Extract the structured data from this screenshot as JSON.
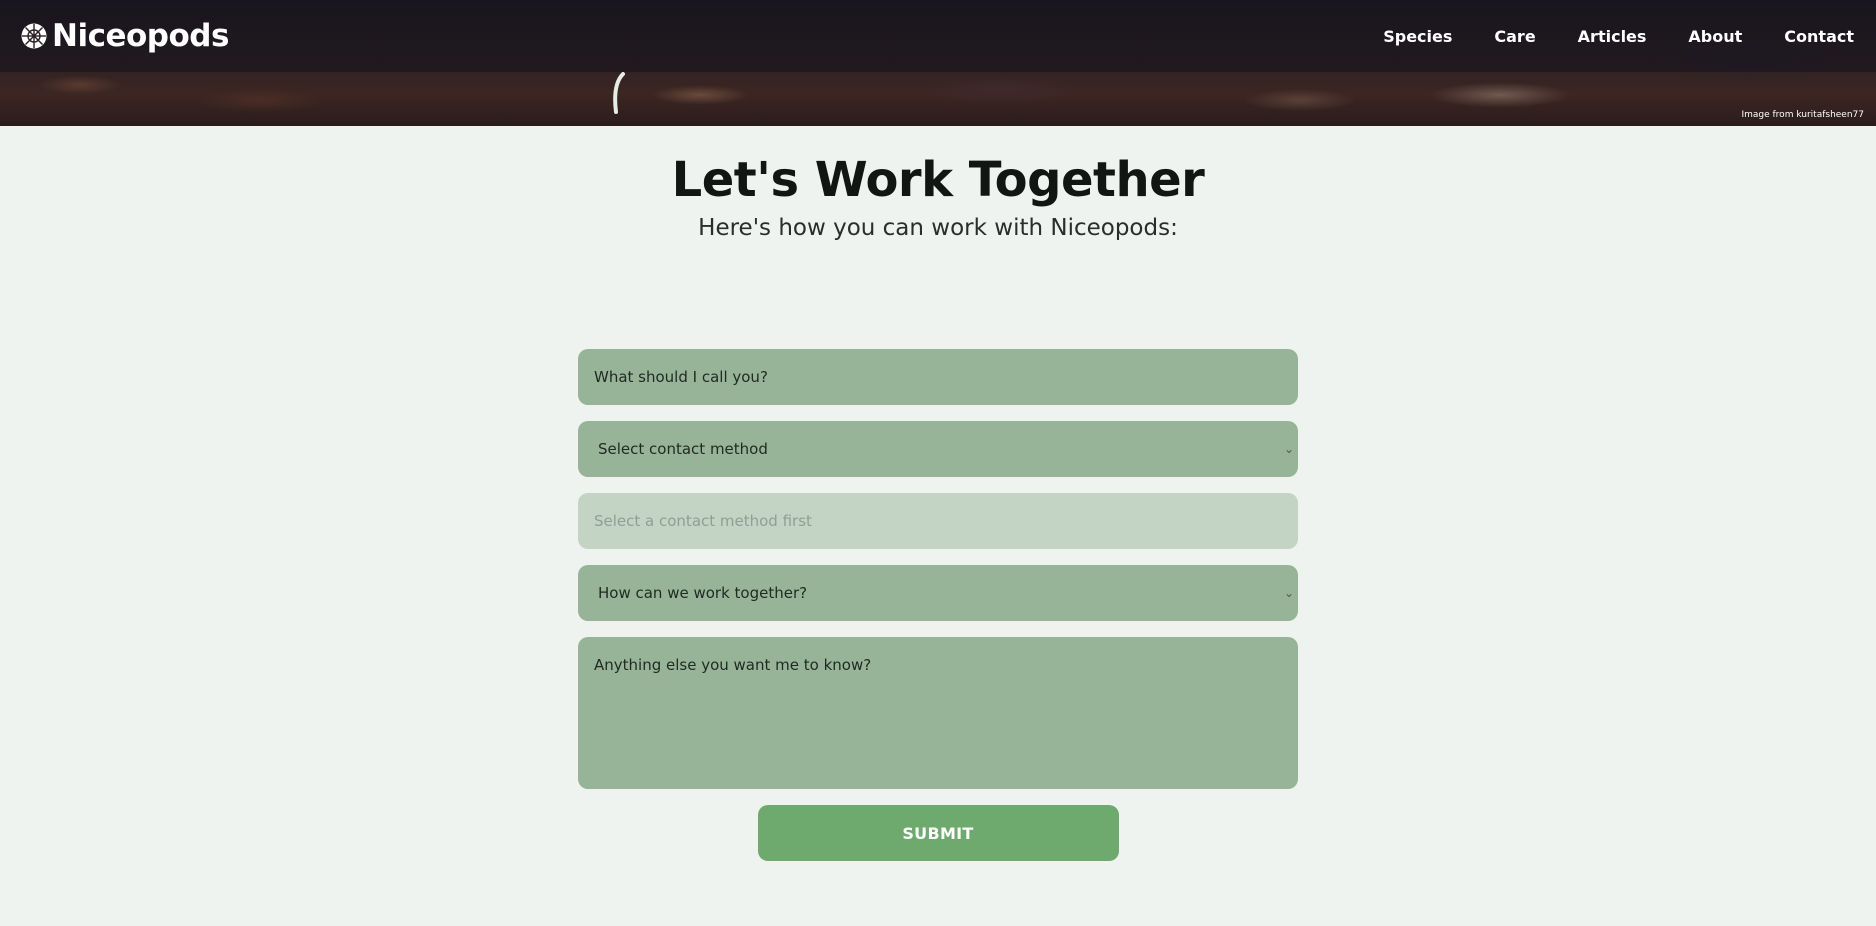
{
  "header": {
    "brand": "Niceopods",
    "brand_icon": "pillbug-icon",
    "nav": [
      "Species",
      "Care",
      "Articles",
      "About",
      "Contact"
    ],
    "image_credit": "Image from kuritafsheen77"
  },
  "main": {
    "title": "Let's Work Together",
    "subtitle": "Here's how you can work with Niceopods:"
  },
  "form": {
    "name_placeholder": "What should I call you?",
    "contact_method": "Select contact method",
    "contact_detail_placeholder": "Select a contact method first",
    "collaboration": "How can we work together?",
    "message_placeholder": "Anything else you want me to know?",
    "submit_label": "SUBMIT"
  },
  "colors": {
    "field_bg": "#98b498",
    "field_disabled_bg": "#c3d4c4",
    "submit_bg": "#6ea96e",
    "page_bg": "#eff3ef"
  }
}
